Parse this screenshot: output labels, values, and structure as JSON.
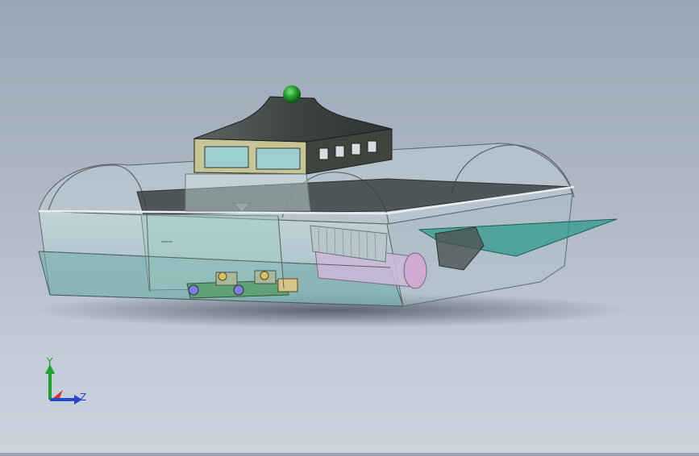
{
  "viewport": {
    "background_top": "#9aa6b6",
    "background_bottom": "#cbd3dd",
    "model": "hovercraft-assembly"
  },
  "triad": {
    "y_label": "Y",
    "z_label": "Z",
    "colors": {
      "y": "#1ea030",
      "z": "#2746c8",
      "x": "#d03a2a"
    }
  }
}
